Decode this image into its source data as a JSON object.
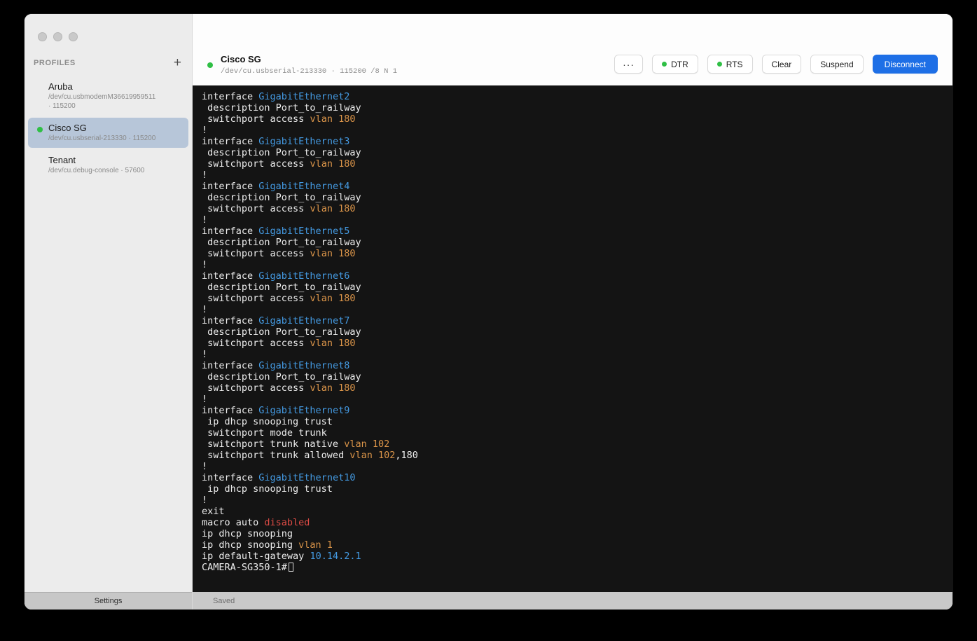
{
  "colors": {
    "accent_blue": "#1e6fe6",
    "status_green": "#2fbf45",
    "term_blue": "#449ae2",
    "term_orange": "#da9449",
    "term_red": "#dd4b45"
  },
  "sidebar": {
    "profiles_header": "PROFILES",
    "add_label": "+",
    "items": [
      {
        "name": "Aruba",
        "detail": "/dev/cu.usbmodemM36619959511\n· 115200",
        "selected": false,
        "connected": false
      },
      {
        "name": "Cisco SG",
        "detail": "/dev/cu.usbserial-213330 · 115200",
        "selected": true,
        "connected": true
      },
      {
        "name": "Tenant",
        "detail": "/dev/cu.debug-console · 57600",
        "selected": false,
        "connected": false
      }
    ],
    "settings_label": "Settings"
  },
  "header": {
    "title": "Cisco SG",
    "subtitle": "/dev/cu.usbserial-213330 · 115200 /8 N 1",
    "more_label": "···",
    "toggles": [
      {
        "label": "DTR",
        "on": true
      },
      {
        "label": "RTS",
        "on": true
      }
    ],
    "clear_label": "Clear",
    "suspend_label": "Suspend",
    "disconnect_label": "Disconnect"
  },
  "terminal": {
    "lines": [
      [
        [
          "interface ",
          "w"
        ],
        [
          "GigabitEthernet2",
          "b"
        ]
      ],
      [
        [
          " description Port_to_railway",
          "w"
        ]
      ],
      [
        [
          " switchport access ",
          "w"
        ],
        [
          "vlan 180",
          "o"
        ]
      ],
      [
        [
          "!",
          "w"
        ]
      ],
      [
        [
          "interface ",
          "w"
        ],
        [
          "GigabitEthernet3",
          "b"
        ]
      ],
      [
        [
          " description Port_to_railway",
          "w"
        ]
      ],
      [
        [
          " switchport access ",
          "w"
        ],
        [
          "vlan 180",
          "o"
        ]
      ],
      [
        [
          "!",
          "w"
        ]
      ],
      [
        [
          "interface ",
          "w"
        ],
        [
          "GigabitEthernet4",
          "b"
        ]
      ],
      [
        [
          " description Port_to_railway",
          "w"
        ]
      ],
      [
        [
          " switchport access ",
          "w"
        ],
        [
          "vlan 180",
          "o"
        ]
      ],
      [
        [
          "!",
          "w"
        ]
      ],
      [
        [
          "interface ",
          "w"
        ],
        [
          "GigabitEthernet5",
          "b"
        ]
      ],
      [
        [
          " description Port_to_railway",
          "w"
        ]
      ],
      [
        [
          " switchport access ",
          "w"
        ],
        [
          "vlan 180",
          "o"
        ]
      ],
      [
        [
          "!",
          "w"
        ]
      ],
      [
        [
          "interface ",
          "w"
        ],
        [
          "GigabitEthernet6",
          "b"
        ]
      ],
      [
        [
          " description Port_to_railway",
          "w"
        ]
      ],
      [
        [
          " switchport access ",
          "w"
        ],
        [
          "vlan 180",
          "o"
        ]
      ],
      [
        [
          "!",
          "w"
        ]
      ],
      [
        [
          "interface ",
          "w"
        ],
        [
          "GigabitEthernet7",
          "b"
        ]
      ],
      [
        [
          " description Port_to_railway",
          "w"
        ]
      ],
      [
        [
          " switchport access ",
          "w"
        ],
        [
          "vlan 180",
          "o"
        ]
      ],
      [
        [
          "!",
          "w"
        ]
      ],
      [
        [
          "interface ",
          "w"
        ],
        [
          "GigabitEthernet8",
          "b"
        ]
      ],
      [
        [
          " description Port_to_railway",
          "w"
        ]
      ],
      [
        [
          " switchport access ",
          "w"
        ],
        [
          "vlan 180",
          "o"
        ]
      ],
      [
        [
          "!",
          "w"
        ]
      ],
      [
        [
          "interface ",
          "w"
        ],
        [
          "GigabitEthernet9",
          "b"
        ]
      ],
      [
        [
          " ip dhcp snooping trust",
          "w"
        ]
      ],
      [
        [
          " switchport mode trunk",
          "w"
        ]
      ],
      [
        [
          " switchport trunk native ",
          "w"
        ],
        [
          "vlan 102",
          "o"
        ]
      ],
      [
        [
          " switchport trunk allowed ",
          "w"
        ],
        [
          "vlan 102",
          "o"
        ],
        [
          ",180",
          "w"
        ]
      ],
      [
        [
          "!",
          "w"
        ]
      ],
      [
        [
          "interface ",
          "w"
        ],
        [
          "GigabitEthernet10",
          "b"
        ]
      ],
      [
        [
          " ip dhcp snooping trust",
          "w"
        ]
      ],
      [
        [
          "!",
          "w"
        ]
      ],
      [
        [
          "exit",
          "w"
        ]
      ],
      [
        [
          "macro auto ",
          "w"
        ],
        [
          "disabled",
          "r"
        ]
      ],
      [
        [
          "ip dhcp snooping",
          "w"
        ]
      ],
      [
        [
          "ip dhcp snooping ",
          "w"
        ],
        [
          "vlan 1",
          "o"
        ]
      ],
      [
        [
          "ip default-gateway ",
          "w"
        ],
        [
          "10.14.2.1",
          "b"
        ]
      ]
    ],
    "prompt": "CAMERA-SG350-1#"
  },
  "statusbar": {
    "saved_label": "Saved"
  }
}
